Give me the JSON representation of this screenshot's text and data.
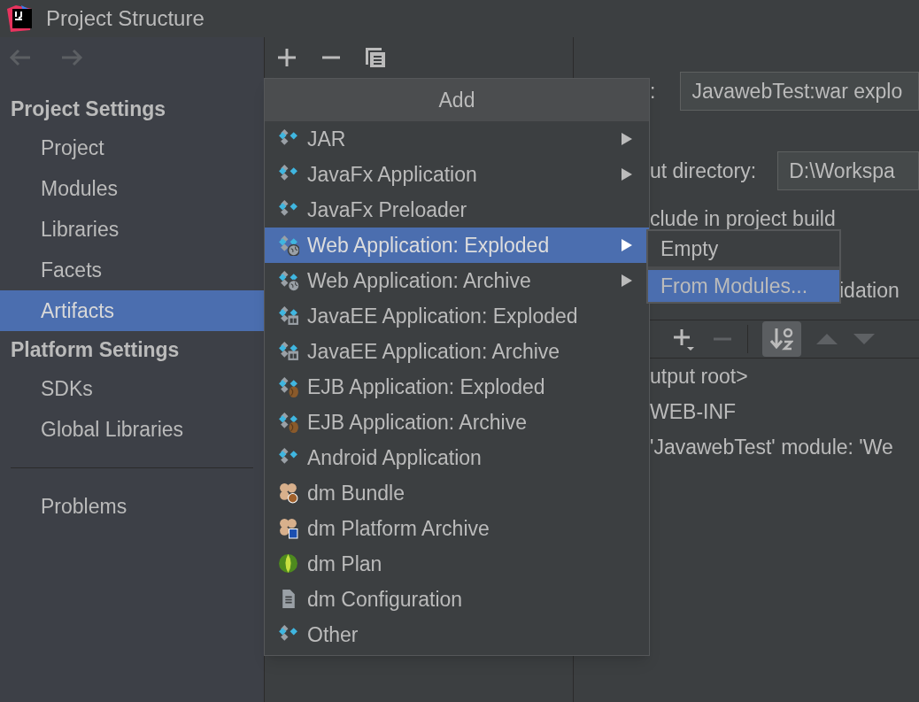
{
  "window": {
    "title": "Project Structure"
  },
  "sidebar": {
    "sections": [
      {
        "title": "Project Settings",
        "items": [
          {
            "label": "Project",
            "selected": false
          },
          {
            "label": "Modules",
            "selected": false
          },
          {
            "label": "Libraries",
            "selected": false
          },
          {
            "label": "Facets",
            "selected": false
          },
          {
            "label": "Artifacts",
            "selected": true
          }
        ]
      },
      {
        "title": "Platform Settings",
        "items": [
          {
            "label": "SDKs",
            "selected": false
          },
          {
            "label": "Global Libraries",
            "selected": false
          }
        ]
      }
    ],
    "bottom_items": [
      {
        "label": "Problems",
        "selected": false
      }
    ]
  },
  "details": {
    "type_label": ":",
    "type_value": "JavawebTest:war explo",
    "output_label": "ut directory:",
    "output_value": "D:\\Workspa",
    "include_label": "clude in project build",
    "validation_label": "idation",
    "tree": [
      {
        "label": "utput root>"
      },
      {
        "label": "WEB-INF"
      },
      {
        "label": "'JavawebTest' module: 'We"
      }
    ]
  },
  "add_menu": {
    "title": "Add",
    "items": [
      {
        "label": "JAR",
        "kind": "plain",
        "submenu": true,
        "selected": false
      },
      {
        "label": "JavaFx Application",
        "kind": "plain",
        "submenu": true,
        "selected": false
      },
      {
        "label": "JavaFx Preloader",
        "kind": "plain",
        "submenu": false,
        "selected": false
      },
      {
        "label": "Web Application: Exploded",
        "kind": "web",
        "submenu": true,
        "selected": true
      },
      {
        "label": "Web Application: Archive",
        "kind": "web",
        "submenu": true,
        "selected": false
      },
      {
        "label": "JavaEE Application: Exploded",
        "kind": "javaee",
        "submenu": false,
        "selected": false
      },
      {
        "label": "JavaEE Application: Archive",
        "kind": "javaee",
        "submenu": false,
        "selected": false
      },
      {
        "label": "EJB Application: Exploded",
        "kind": "ejb",
        "submenu": false,
        "selected": false
      },
      {
        "label": "EJB Application: Archive",
        "kind": "ejb",
        "submenu": false,
        "selected": false
      },
      {
        "label": "Android Application",
        "kind": "plain",
        "submenu": false,
        "selected": false
      },
      {
        "label": "dm Bundle",
        "kind": "bundle",
        "submenu": false,
        "selected": false
      },
      {
        "label": "dm Platform Archive",
        "kind": "platform",
        "submenu": false,
        "selected": false
      },
      {
        "label": "dm Plan",
        "kind": "plan",
        "submenu": false,
        "selected": false
      },
      {
        "label": "dm Configuration",
        "kind": "config",
        "submenu": false,
        "selected": false
      },
      {
        "label": "Other",
        "kind": "plain",
        "submenu": false,
        "selected": false
      }
    ]
  },
  "submenu": {
    "items": [
      {
        "label": "Empty",
        "selected": false
      },
      {
        "label": "From Modules...",
        "selected": true
      }
    ]
  }
}
